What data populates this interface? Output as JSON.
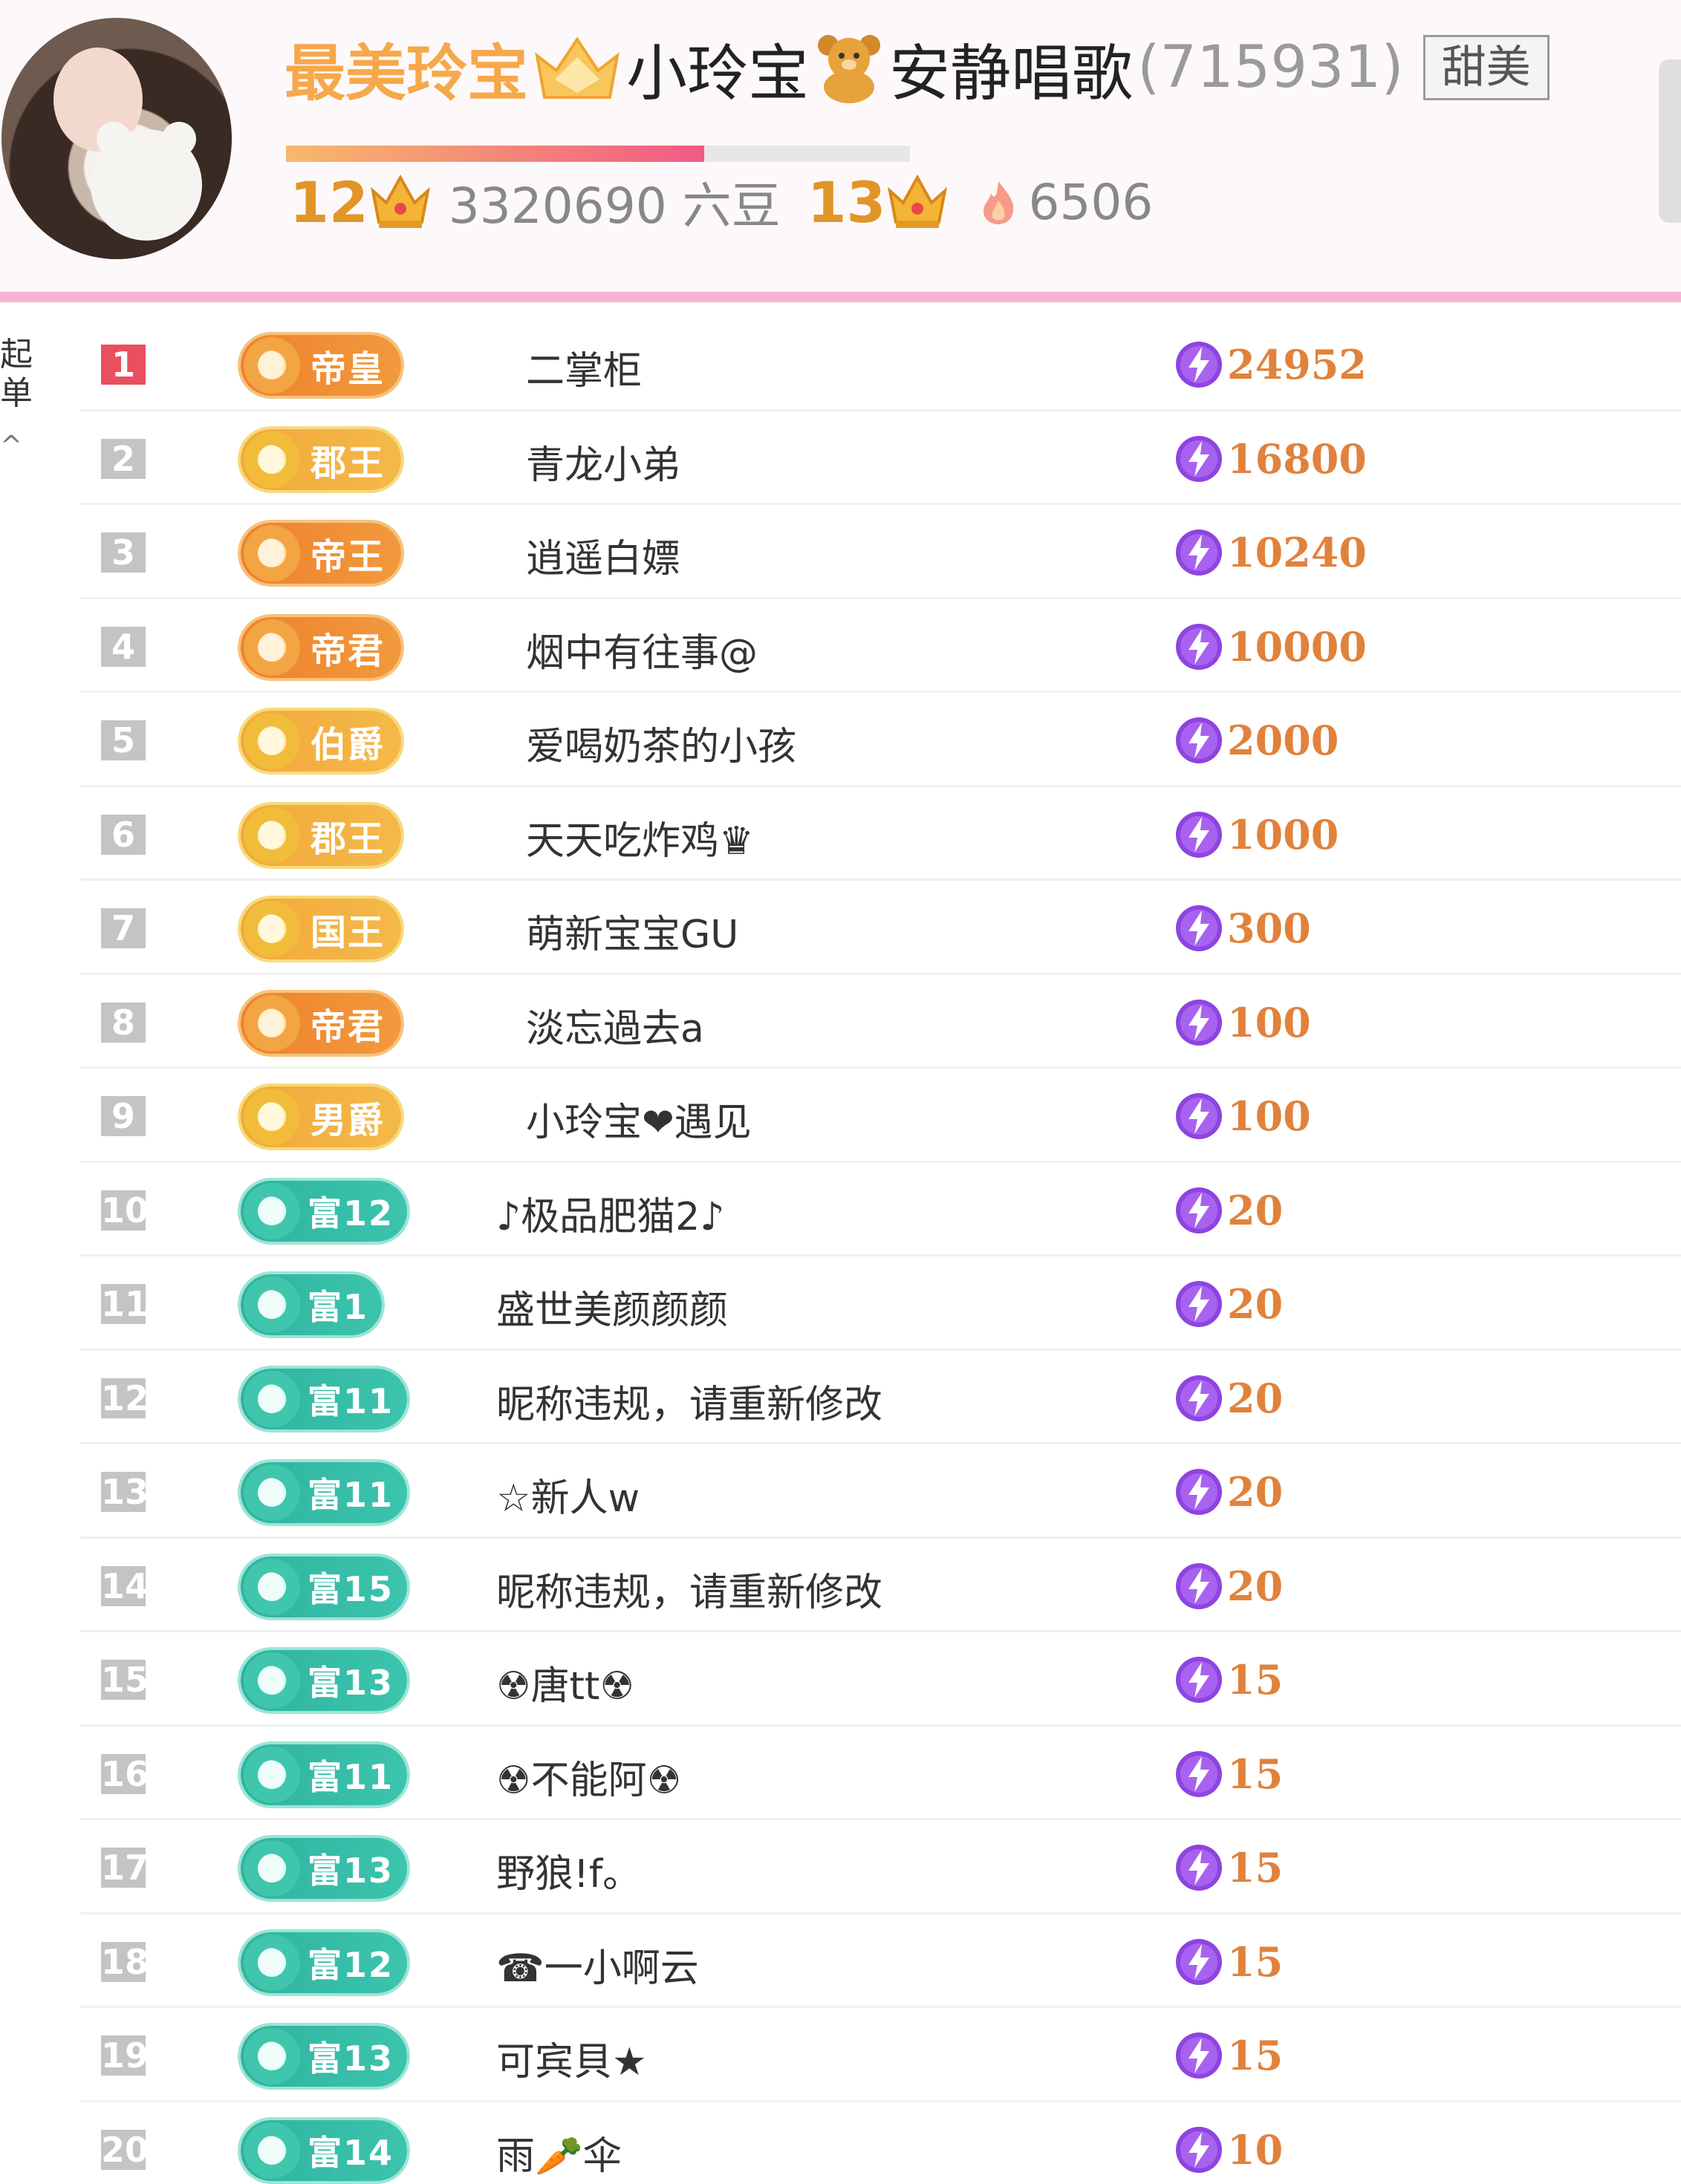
{
  "header": {
    "title_prefix": "最美玲宝",
    "title_name": "小玲宝",
    "title_suffix": "安静唱歌",
    "room_id": "(715931)",
    "tag": "甜美",
    "progress": 0.67,
    "current_level": "12",
    "beans": "3320690 六豆",
    "next_level": "13",
    "fire_count": "6506"
  },
  "side": {
    "text": "起单",
    "caret": "^"
  },
  "rows": [
    {
      "rank": "1",
      "badge": "帝皇",
      "badge_style": "orange",
      "name": "二掌柜",
      "score": "24952"
    },
    {
      "rank": "2",
      "badge": "郡王",
      "badge_style": "gold",
      "name": "青龙小弟",
      "score": "16800"
    },
    {
      "rank": "3",
      "badge": "帝王",
      "badge_style": "orange",
      "name": "逍遥白嫖",
      "score": "10240"
    },
    {
      "rank": "4",
      "badge": "帝君",
      "badge_style": "orange",
      "name": "烟中有往事@",
      "score": "10000"
    },
    {
      "rank": "5",
      "badge": "伯爵",
      "badge_style": "gold",
      "name": "爱喝奶茶的小孩",
      "score": "2000"
    },
    {
      "rank": "6",
      "badge": "郡王",
      "badge_style": "gold",
      "name": "天天吃炸鸡♛",
      "score": "1000"
    },
    {
      "rank": "7",
      "badge": "国王",
      "badge_style": "gold",
      "name": "萌新宝宝GU",
      "score": "300"
    },
    {
      "rank": "8",
      "badge": "帝君",
      "badge_style": "orange",
      "name": "淡忘過去a",
      "score": "100"
    },
    {
      "rank": "9",
      "badge": "男爵",
      "badge_style": "gold",
      "name": "小玲宝❤遇见",
      "score": "100"
    },
    {
      "rank": "10",
      "badge": "富12",
      "badge_style": "teal",
      "name": "♪极品肥猫2♪",
      "score": "20"
    },
    {
      "rank": "11",
      "badge": "富1",
      "badge_style": "teal",
      "name": "盛世美颜颜颜",
      "score": "20"
    },
    {
      "rank": "12",
      "badge": "富11",
      "badge_style": "teal",
      "name": "昵称违规，请重新修改",
      "score": "20"
    },
    {
      "rank": "13",
      "badge": "富11",
      "badge_style": "teal",
      "name": "☆新人w",
      "score": "20"
    },
    {
      "rank": "14",
      "badge": "富15",
      "badge_style": "teal",
      "name": "昵称违规，请重新修改",
      "score": "20"
    },
    {
      "rank": "15",
      "badge": "富13",
      "badge_style": "teal",
      "name": "☢唐tt☢",
      "score": "15"
    },
    {
      "rank": "16",
      "badge": "富11",
      "badge_style": "teal",
      "name": "☢不能阿☢",
      "score": "15"
    },
    {
      "rank": "17",
      "badge": "富13",
      "badge_style": "teal",
      "name": "野狼!f。",
      "score": "15"
    },
    {
      "rank": "18",
      "badge": "富12",
      "badge_style": "teal",
      "name": "☎一小啊云",
      "score": "15"
    },
    {
      "rank": "19",
      "badge": "富13",
      "badge_style": "teal",
      "name": "可宾貝★",
      "score": "15"
    },
    {
      "rank": "20",
      "badge": "富14",
      "badge_style": "teal",
      "name": "雨🥕伞",
      "score": "10"
    }
  ]
}
